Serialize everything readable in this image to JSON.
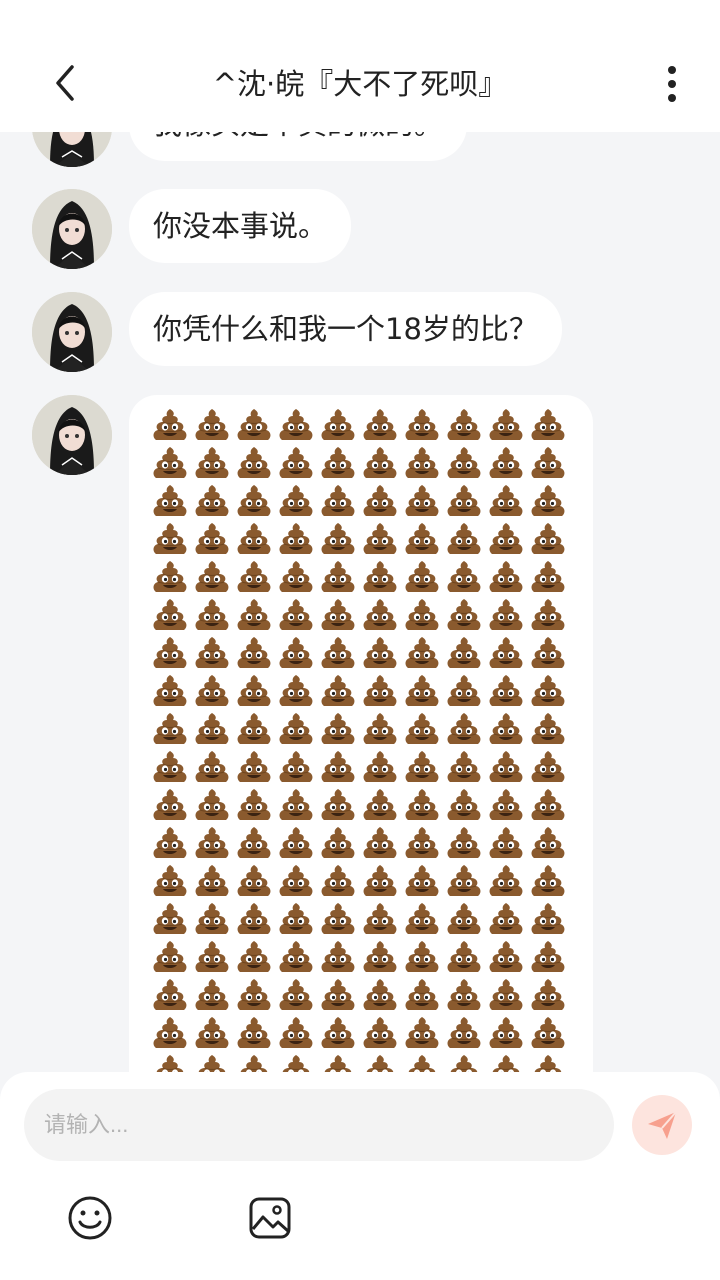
{
  "header": {
    "title": "^沈·皖『大不了死呗』",
    "back_icon": "chevron-left-icon",
    "more_icon": "more-vertical-icon"
  },
  "messages": [
    {
      "sender": "other",
      "text": "我像头是个真的微的。"
    },
    {
      "sender": "other",
      "text": "你没本事说。"
    },
    {
      "sender": "other",
      "text": "你凭什么和我一个18岁的比？"
    },
    {
      "sender": "other",
      "type": "emoji-flood",
      "emoji": "pile-of-poo-icon",
      "columns": 10,
      "visible_rows": 17
    }
  ],
  "composer": {
    "placeholder": "请输入...",
    "send_icon": "paper-plane-icon",
    "send_color": "#f7a08e",
    "emoji_icon": "smiley-icon",
    "image_icon": "image-icon"
  }
}
